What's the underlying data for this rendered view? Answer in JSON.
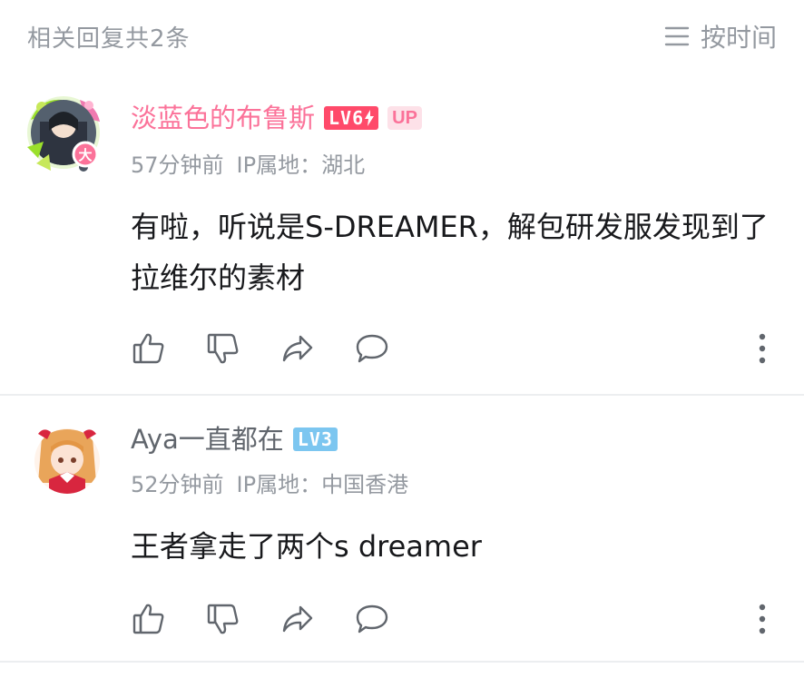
{
  "header": {
    "title": "相关回复共2条",
    "sort_label": "按时间",
    "sort_icon": "list-icon"
  },
  "comments": [
    {
      "username": "淡蓝色的布鲁斯",
      "name_color": "#fb7299",
      "level": "LV6",
      "level_color": "#ff4a6a",
      "badge": "UP",
      "time": "57分钟前",
      "location": "IP属地：湖北",
      "content": "有啦，听说是S-DREAMER，解包研发服发现到了拉维尔的素材"
    },
    {
      "username": "Aya一直都在",
      "name_color": "#61666d",
      "level": "LV3",
      "level_color": "#7cc6f0",
      "time": "52分钟前",
      "location": "IP属地：中国香港",
      "content": "王者拿走了两个s dreamer"
    }
  ],
  "action_icons": [
    "like-icon",
    "dislike-icon",
    "share-icon",
    "reply-icon",
    "more-icon"
  ],
  "colors": {
    "muted_text": "#9499a0",
    "body_text": "#18191c",
    "pink": "#fb7299",
    "divider": "#eceef0"
  }
}
